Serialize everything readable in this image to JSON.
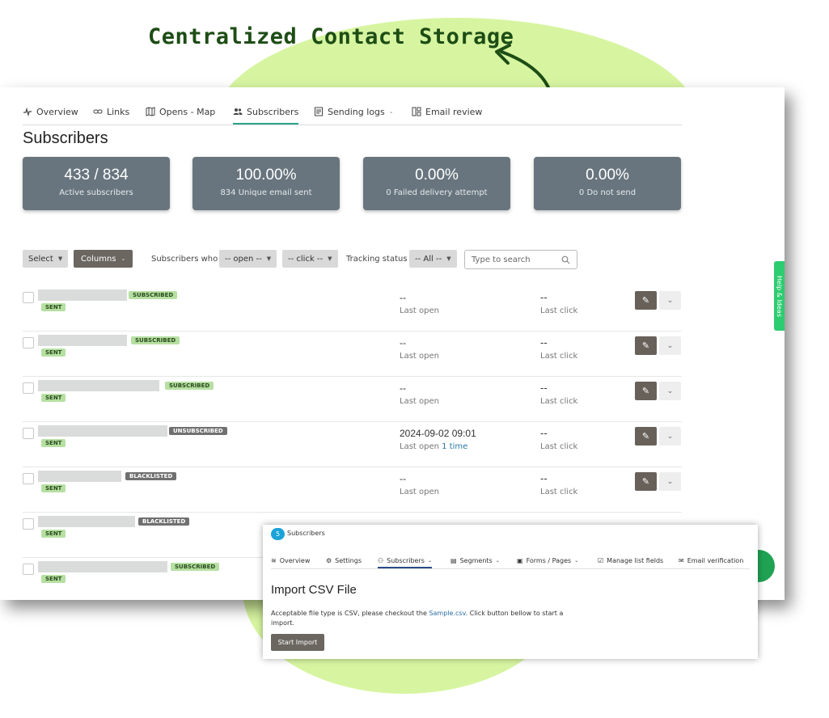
{
  "headline": "Centralized Contact Storage",
  "tabs": [
    {
      "label": "Overview",
      "icon": "activity-icon"
    },
    {
      "label": "Links",
      "icon": "link-icon"
    },
    {
      "label": "Opens - Map",
      "icon": "map-icon"
    },
    {
      "label": "Subscribers",
      "icon": "users-icon",
      "active": true
    },
    {
      "label": "Sending logs",
      "icon": "document-icon"
    },
    {
      "label": "Email review",
      "icon": "layout-icon"
    }
  ],
  "page_title": "Subscribers",
  "stats": [
    {
      "value": "433 / 834",
      "label": "Active subscribers"
    },
    {
      "value": "100.00%",
      "label": "834 Unique email sent"
    },
    {
      "value": "0.00%",
      "label": "0 Failed delivery attempt"
    },
    {
      "value": "0.00%",
      "label": "0 Do not send"
    }
  ],
  "filters": {
    "select_label": "Select",
    "columns_label": "Columns",
    "subscribers_who_label": "Subscribers who",
    "open_value": "-- open --",
    "click_value": "-- click --",
    "tracking_status_label": "Tracking status",
    "tracking_value": "-- All --",
    "search_placeholder": "Type to search"
  },
  "rows": [
    {
      "status": "SUBSCRIBED",
      "sent": "SENT",
      "open_value": "--",
      "open_label": "Last open",
      "open_link": "",
      "click_value": "--",
      "click_label": "Last click"
    },
    {
      "status": "SUBSCRIBED",
      "sent": "SENT",
      "open_value": "--",
      "open_label": "Last open",
      "open_link": "",
      "click_value": "--",
      "click_label": "Last click"
    },
    {
      "status": "SUBSCRIBED",
      "sent": "SENT",
      "open_value": "--",
      "open_label": "Last open",
      "open_link": "",
      "click_value": "--",
      "click_label": "Last click"
    },
    {
      "status": "UNSUBSCRIBED",
      "sent": "SENT",
      "open_value": "2024-09-02 09:01",
      "open_label": "Last open",
      "open_link": "1 time",
      "click_value": "--",
      "click_label": "Last click"
    },
    {
      "status": "BLACKLISTED",
      "sent": "SENT",
      "open_value": "--",
      "open_label": "Last open",
      "open_link": "",
      "click_value": "--",
      "click_label": "Last click"
    },
    {
      "status": "BLACKLISTED",
      "sent": "SENT",
      "open_value": "",
      "open_label": "",
      "open_link": "",
      "click_value": "",
      "click_label": ""
    },
    {
      "status": "SUBSCRIBED",
      "sent": "SENT",
      "open_value": "",
      "open_label": "",
      "open_link": "",
      "click_value": "",
      "click_label": ""
    }
  ],
  "side_tab": "Help & Ideas",
  "import_panel": {
    "count_badge": "5",
    "subtitle": "Subscribers",
    "tabs": [
      {
        "label": "Overview",
        "icon": "activity-icon"
      },
      {
        "label": "Settings",
        "icon": "gear-icon"
      },
      {
        "label": "Subscribers",
        "icon": "users-icon",
        "active": true
      },
      {
        "label": "Segments",
        "icon": "segments-icon"
      },
      {
        "label": "Forms / Pages",
        "icon": "form-icon"
      },
      {
        "label": "Manage list fields",
        "icon": "checkbox-icon"
      },
      {
        "label": "Email verification",
        "icon": "mail-check-icon"
      }
    ],
    "title": "Import CSV File",
    "desc_before": "Acceptable file type is CSV, please checkout the ",
    "desc_link": "Sample.csv",
    "desc_after": ". Click button bellow to start a import.",
    "button_label": "Start Import"
  },
  "colors": {
    "accent_green": "#2aa58b",
    "stat_bg": "#68757e",
    "blob": "#d7f5a1",
    "headline": "#1d4d15"
  }
}
